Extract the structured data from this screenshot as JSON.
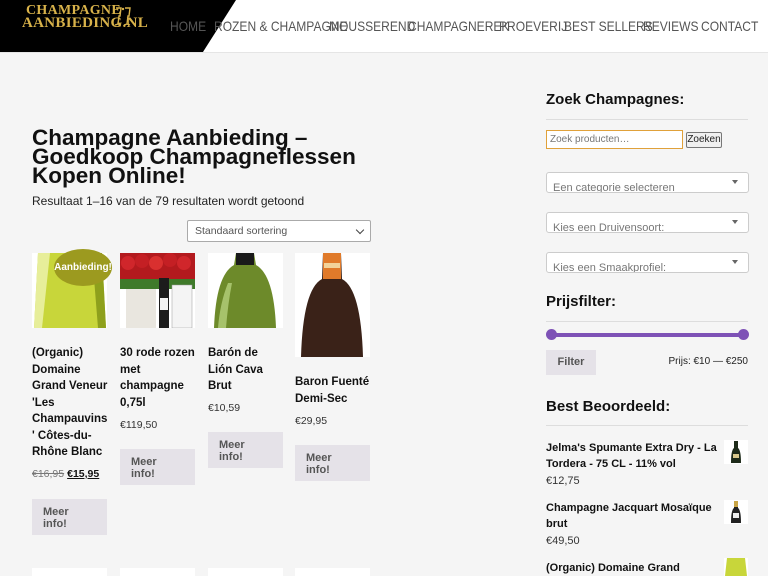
{
  "header": {
    "logo_line1": "CHAMPAGNE",
    "logo_line2": "AANBIEDING.NL",
    "nav": [
      "HOME",
      "ROZEN & CHAMPAGNE",
      "MOUSSEREND",
      "CHAMPAGNEREK",
      "PROEVERIJ",
      "BEST SELLERS",
      "REVIEWS",
      "CONTACT"
    ]
  },
  "main": {
    "title_lines": [
      "Champagne Aanbieding –",
      "Goedkoop Champagneflessen",
      "Kopen Online!"
    ],
    "result_count": "Resultaat 1–16 van de 79 resultaten wordt getoond",
    "sort_selected": "Standaard sortering",
    "badge": "Aanbieding!",
    "more_info": [
      "Meer",
      "info!"
    ],
    "products": [
      {
        "name_lines": [
          "(Organic)",
          "Domaine",
          "Grand Veneur",
          "'Les",
          "Champauvins",
          "' Côtes-du-",
          "Rhône Blanc"
        ],
        "old_price": "€16,95",
        "price": "€15,95"
      },
      {
        "name_lines": [
          "30 rode rozen",
          "met",
          "champagne",
          "0,75l"
        ],
        "price": "€119,50"
      },
      {
        "name_lines": [
          "Barón de",
          "Lión Cava",
          "Brut"
        ],
        "price": "€10,59"
      },
      {
        "name_lines": [
          "Baron Fuenté",
          "Demi-Sec"
        ],
        "price": "€29,95"
      }
    ]
  },
  "sidebar": {
    "search_title": "Zoek Champagnes:",
    "search_placeholder": "Zoek producten…",
    "search_button": "Zoeken",
    "category_select": "Een categorie selecteren",
    "grape_select": "Kies een Druivensoort:",
    "taste_select": "Kies een Smaakprofiel:",
    "price_filter_title": "Prijsfilter:",
    "filter_button": "Filter",
    "price_range": "Prijs: €10 — €250",
    "best_rated_title": "Best Beoordeeld:",
    "best_rated": [
      {
        "name_lines": [
          "Jelma's Spumante Extra Dry - La",
          "Tordera - 75 CL - 11% vol"
        ],
        "price": "€12,75"
      },
      {
        "name_lines": [
          "Champagne Jacquart Mosaïque",
          "brut"
        ],
        "price": "€49,50"
      },
      {
        "name_lines": [
          "(Organic) Domaine Grand"
        ],
        "price": ""
      }
    ]
  },
  "colors": {
    "accent": "#7e52b6",
    "logo_gold": "#d8b24a",
    "badge": "#9c9a1f",
    "button_bg": "#e5e2e8"
  }
}
